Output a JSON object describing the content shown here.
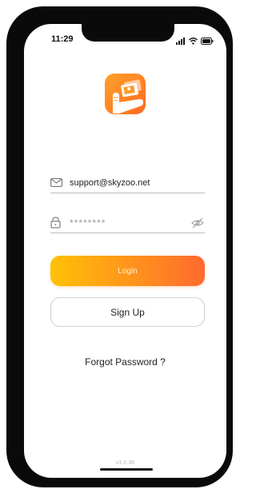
{
  "status_bar": {
    "time": "11:29",
    "icons": [
      "cellular-signal-icon",
      "wifi-icon",
      "battery-icon"
    ]
  },
  "logo": {
    "icon": "app-logo-photos-hand",
    "colors": [
      "#ffa12b",
      "#ff6a1f"
    ]
  },
  "email": {
    "icon": "mail-icon",
    "value": "support@skyzoo.net"
  },
  "password": {
    "icon": "lock-icon",
    "value": "********",
    "toggle_icon": "eye-off-icon"
  },
  "buttons": {
    "login_label": "Login",
    "signup_label": "Sign Up"
  },
  "forgot_password_label": "Forgot Password ?",
  "version": "v1.0.38",
  "colors": {
    "accent_start": "#ffc107",
    "accent_end": "#ff6a2e"
  }
}
